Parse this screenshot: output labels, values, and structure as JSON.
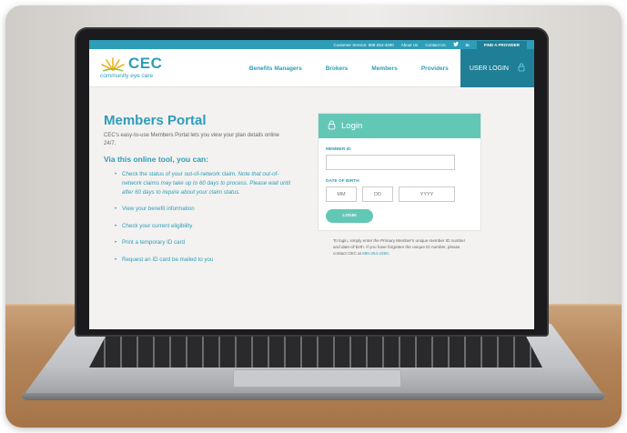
{
  "topbar": {
    "customer_service": "Customer Service: 888-254-4290",
    "about": "About Us",
    "contact": "Contact Us",
    "twitter_icon": "twitter-icon",
    "linkedin_icon": "linkedin-icon",
    "find_provider": "FIND A PROVIDER"
  },
  "logo": {
    "brand": "CEC",
    "tagline": "community eye care"
  },
  "nav": {
    "items": [
      "Benefits Managers",
      "Brokers",
      "Members",
      "Providers"
    ],
    "user_login": "USER LOGIN"
  },
  "main": {
    "title": "Members Portal",
    "intro": "CEC's easy-to-use Members Portal lets you view your plan details online 24/7.",
    "subtitle": "Via this online tool, you can:",
    "list": [
      {
        "text": "Check the status of your out-of-network claim. ",
        "note": "Note that out-of-network claims may take up to 60 days to process. Please wait until after 60 days to inquire about your claim status."
      },
      {
        "text": "View your benefit information",
        "note": ""
      },
      {
        "text": "Check your current eligibility",
        "note": ""
      },
      {
        "text": "Print a temporary ID card",
        "note": ""
      },
      {
        "text": "Request an ID card be mailed to you",
        "note": ""
      }
    ]
  },
  "login": {
    "title": "Login",
    "member_id_label": "MEMBER ID",
    "dob_label": "DATE OF BIRTH",
    "mm": "MM",
    "dd": "DD",
    "yyyy": "YYYY",
    "button": "LOGIN",
    "help_text": "To login, simply enter the Primary Member's unique member ID number and date-of-birth. If you have forgotten the unique ID number, please contact CEC at ",
    "help_phone": "888-254-4290",
    "help_end": "."
  },
  "colors": {
    "accent": "#2e9db8",
    "teal": "#63c7b6",
    "dark_accent": "#1f7f96"
  }
}
